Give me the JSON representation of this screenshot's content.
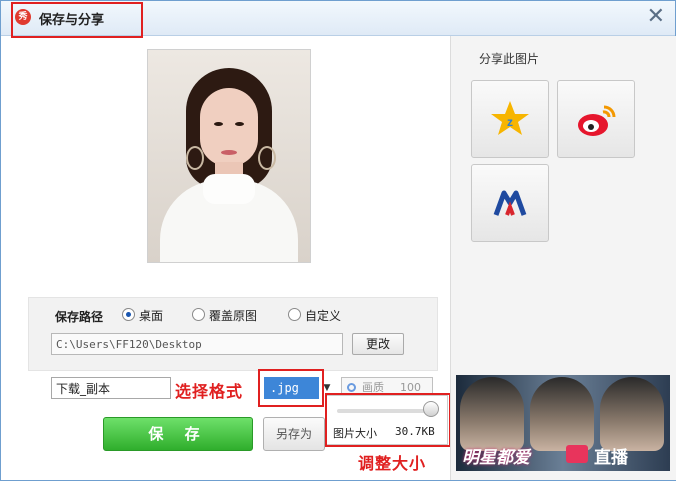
{
  "window": {
    "title": "保存与分享",
    "logo_text": "秀",
    "close_glyph": "✕"
  },
  "save": {
    "path_label": "保存路径",
    "options": [
      "桌面",
      "覆盖原图",
      "自定义"
    ],
    "selected_option": "桌面",
    "path_value": "C:\\Users\\FF120\\Desktop",
    "change_button": "更改",
    "filename": "下载_副本",
    "format": ".jpg",
    "quality_label": "画质",
    "quality_value": "100",
    "quality_level": 1.0,
    "size_label": "图片大小",
    "size_value": "30.7KB",
    "save_button": "保 存",
    "save_as_button": "另存为"
  },
  "annotations": {
    "format_note": "选择格式",
    "resize_note": "调整大小",
    "color": "#e02020"
  },
  "share": {
    "title": "分享此图片",
    "targets": [
      {
        "name": "QQ空间",
        "icon": "qzone-star-icon"
      },
      {
        "name": "新浪微博",
        "icon": "weibo-icon"
      },
      {
        "name": "人人网",
        "icon": "renren-icon"
      }
    ]
  },
  "ad": {
    "text_left": "明星都爱",
    "text_right": "直播"
  },
  "colors": {
    "accent_blue": "#3d86d8",
    "save_green": "#2fae2c",
    "title_bg": "#dfeaf6"
  }
}
